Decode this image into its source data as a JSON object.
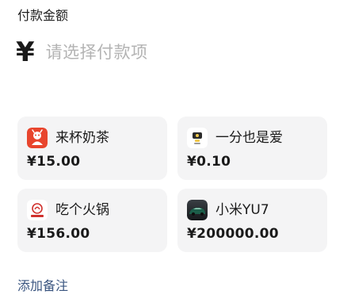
{
  "header": {
    "title": "付款金额"
  },
  "amount": {
    "currency_symbol": "¥",
    "placeholder": "请选择付款项"
  },
  "items": [
    {
      "name": "来杯奶茶",
      "price": "¥15.00",
      "icon": "milk-tea-app-icon"
    },
    {
      "name": "一分也是爱",
      "price": "¥0.10",
      "icon": "coin-gift-icon"
    },
    {
      "name": "吃个火锅",
      "price": "¥156.00",
      "icon": "hotpot-brand-icon"
    },
    {
      "name": "小米YU7",
      "price": "¥200000.00",
      "icon": "green-car-icon"
    }
  ],
  "footer": {
    "add_note": "添加备注"
  },
  "colors": {
    "accent_link": "#3a5580",
    "placeholder": "#b3b3b3",
    "card_bg": "#f4f4f5",
    "milk_tea_red": "#e8452d",
    "hotpot_red": "#d0312d",
    "car_green": "#1c5e4a"
  }
}
